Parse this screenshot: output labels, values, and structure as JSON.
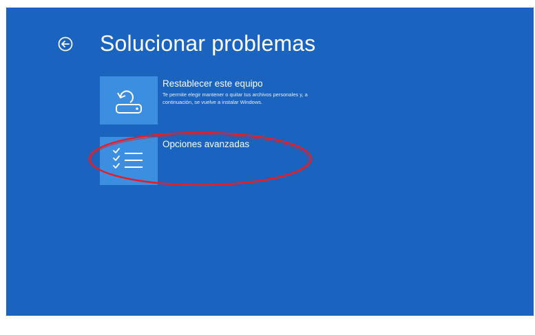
{
  "page": {
    "title": "Solucionar problemas",
    "back_icon": "back-arrow-circle-icon"
  },
  "options": [
    {
      "title": "Restablecer este equipo",
      "description": "Te permite elegir mantener o quitar tus archivos personales y, a continuación, se vuelve a instalar Windows.",
      "icon": "reset-pc-icon"
    },
    {
      "title": "Opciones avanzadas",
      "description": "",
      "icon": "checklist-icon"
    }
  ],
  "colors": {
    "background": "#1a64c0",
    "tile": "#3c8ee0",
    "text": "#ffffff",
    "annotation": "#e0202a"
  },
  "annotation": {
    "shape": "ellipse",
    "highlights": "Opciones avanzadas"
  }
}
